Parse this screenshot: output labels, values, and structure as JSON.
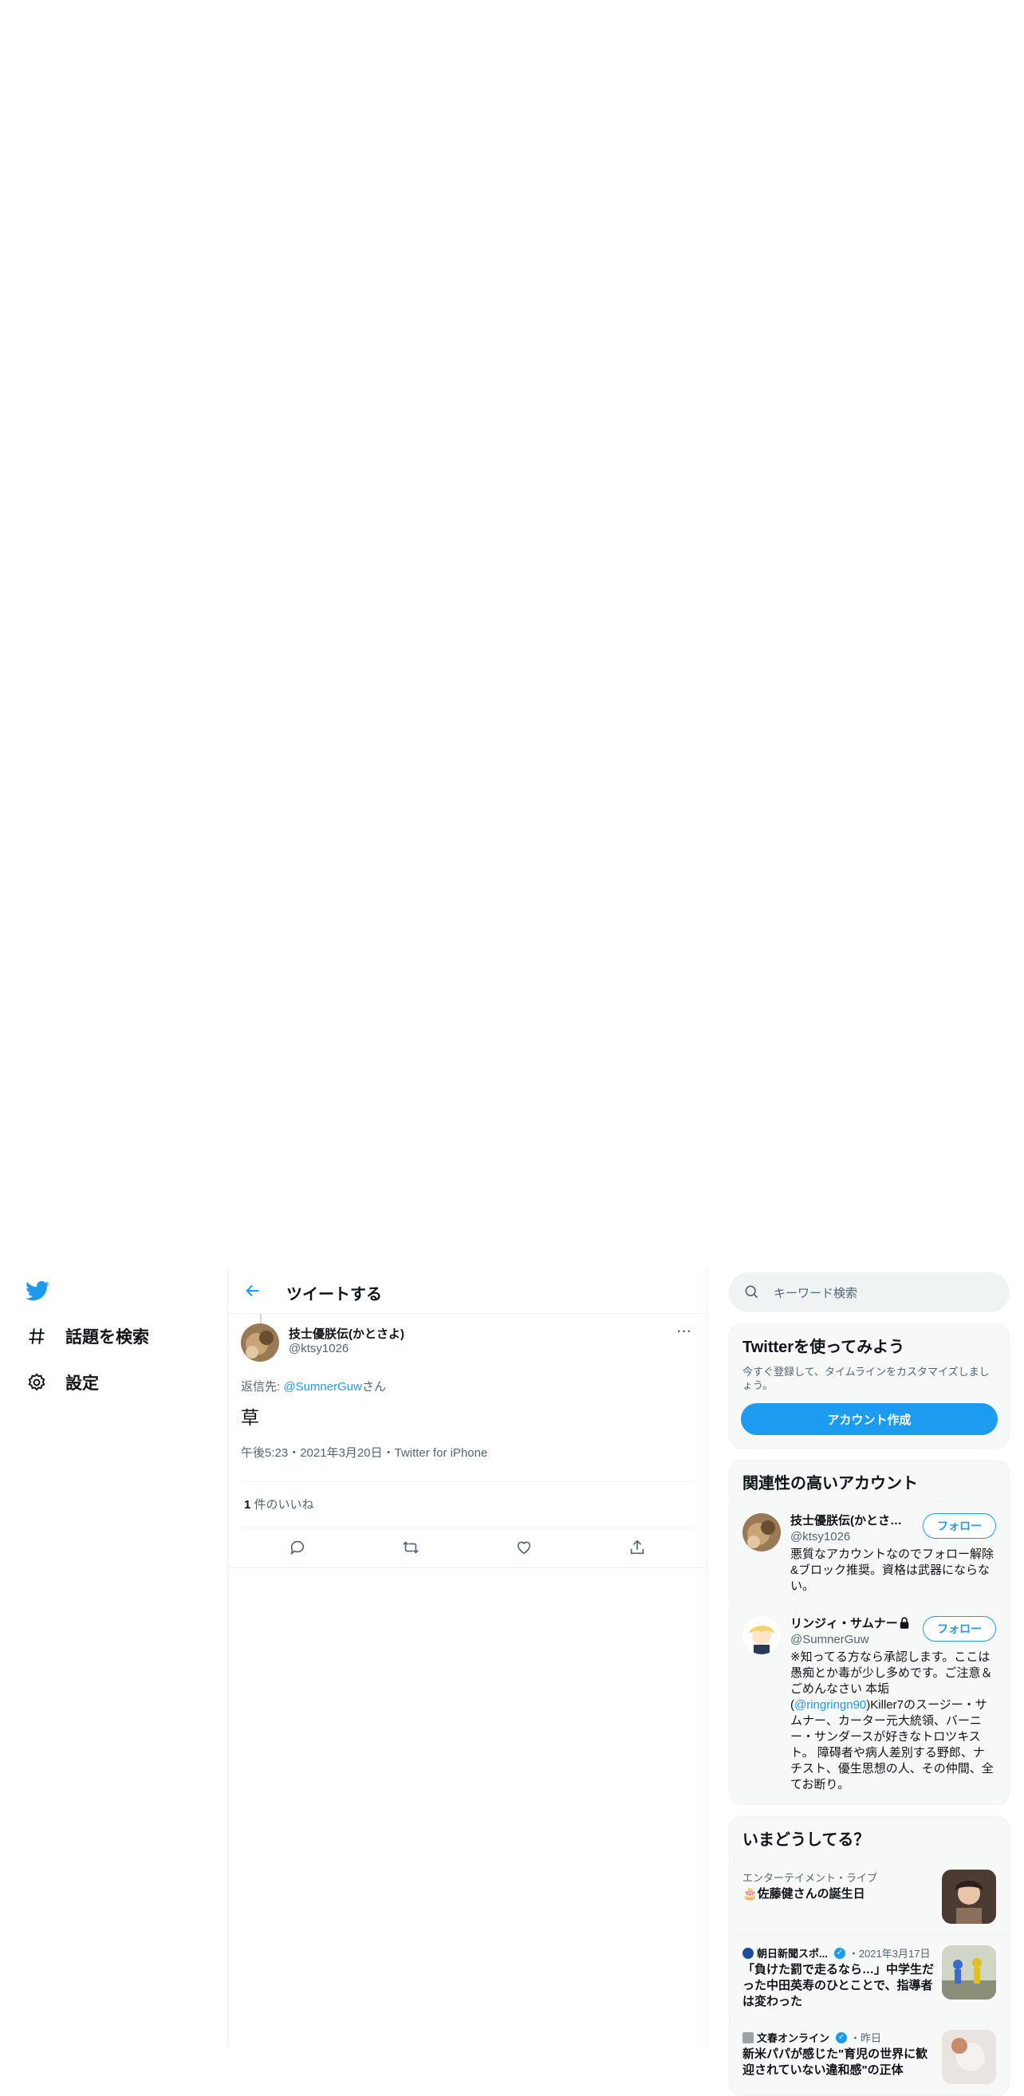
{
  "nav": {
    "items": [
      {
        "label": "話題を検索",
        "icon": "hashtag-icon"
      },
      {
        "label": "設定",
        "icon": "gear-icon"
      }
    ]
  },
  "header": {
    "title": "ツイートする"
  },
  "tweet": {
    "author_name": "技士優朕伝(かとさよ)",
    "author_handle": "@ktsy1026",
    "more": "···",
    "reply_prefix": "返信先: ",
    "reply_mention": "@SumnerGuw",
    "reply_suffix": "さん",
    "text": "草",
    "meta": "午後5:23・2021年3月20日・Twitter for iPhone",
    "like_count": "1",
    "like_label": " 件のいいね"
  },
  "search": {
    "placeholder": "キーワード検索"
  },
  "signup": {
    "title": "Twitterを使ってみよう",
    "subtitle": "今すぐ登録して、タイムラインをカスタマイズしましょう。",
    "button": "アカウント作成"
  },
  "related": {
    "title": "関連性の高いアカウント",
    "follow_label": "フォロー",
    "users": [
      {
        "name": "技士優朕伝(かとさよ)",
        "handle": "@ktsy1026",
        "bio": "悪質なアカウントなのでフォロー解除&ブロック推奨。資格は武器にならない。"
      },
      {
        "name": "リンジィ・サムナー",
        "handle": "@SumnerGuw",
        "bio_pre": "※知ってる方なら承認します。ここは愚痴とか毒が少し多めです。ご注意＆ごめんなさい 本垢(",
        "bio_link": "@ringringn90",
        "bio_post": ")Killer7のスージー・サムナー、カーター元大統領、バーニー・サンダースが好きなトロツキスト。 障碍者や病人差別する野郎、ナチスト、優生思想の人、その仲間、全てお断り。"
      }
    ]
  },
  "trends": {
    "title": "いまどうしてる？",
    "items": [
      {
        "meta": "エンターテイメント・ライブ",
        "title": "🎂佐藤健さんの誕生日"
      },
      {
        "source": "朝日新聞スポ...",
        "date": "・2021年3月17日",
        "title": "「負けた罰で走るなら…」中学生だった中田英寿のひとことで、指導者は変わった"
      },
      {
        "source": "文春オンライン",
        "date": "・昨日",
        "title": "新米パパが感じた\"育児の世界に歓迎されていない違和感\"の正体"
      }
    ]
  },
  "colors": {
    "accent": "#1d9bf0",
    "text": "#0f1419",
    "muted": "#536471"
  }
}
